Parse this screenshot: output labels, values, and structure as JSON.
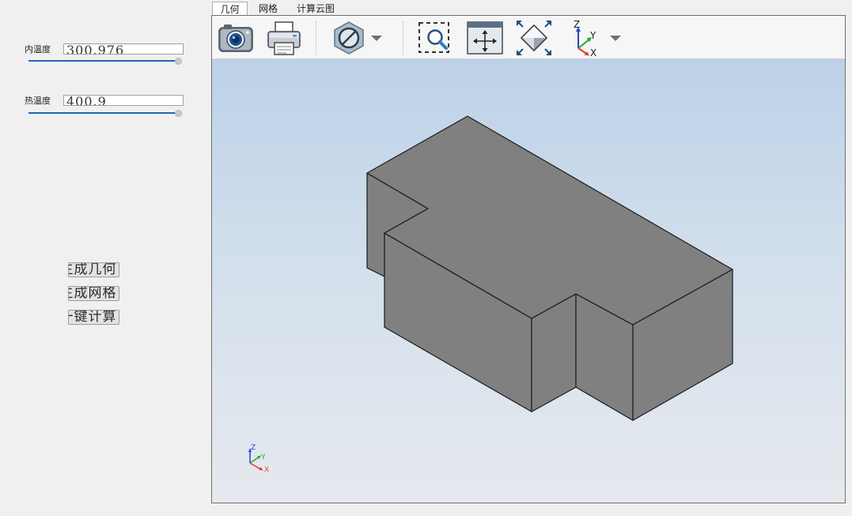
{
  "params": [
    {
      "label": "内温度",
      "value": "300.976"
    },
    {
      "label": "热温度",
      "value": "400.9"
    }
  ],
  "actions": [
    {
      "label": "生成几何"
    },
    {
      "label": "生成网格"
    },
    {
      "label": "一键计算"
    }
  ],
  "tabs": [
    {
      "label": "几何",
      "active": true
    },
    {
      "label": "网格",
      "active": false
    },
    {
      "label": "计算云图",
      "active": false
    }
  ],
  "toolbar": {
    "buttons": [
      {
        "icon": "camera-icon"
      },
      {
        "icon": "printer-icon"
      },
      {
        "icon": "no-symbol-icon"
      },
      {
        "icon": "dropdown-arrow-icon"
      },
      {
        "icon": "zoom-window-icon"
      },
      {
        "icon": "pan-icon"
      },
      {
        "icon": "fit-all-icon"
      },
      {
        "icon": "axes-view-icon"
      },
      {
        "icon": "dropdown-arrow-icon"
      }
    ],
    "axis_labels": {
      "z": "Z",
      "y": "Y",
      "x": "X"
    }
  },
  "viewport": {
    "axis_triad": {
      "z": "Z",
      "y": "Y",
      "x": "X"
    },
    "colors": {
      "solid_face": "#808080",
      "edge": "#1a1a1a",
      "axis_x": "#e23b2e",
      "axis_y": "#2aa52a",
      "axis_z": "#2440c8",
      "slider_accent": "#1f66b3"
    }
  }
}
